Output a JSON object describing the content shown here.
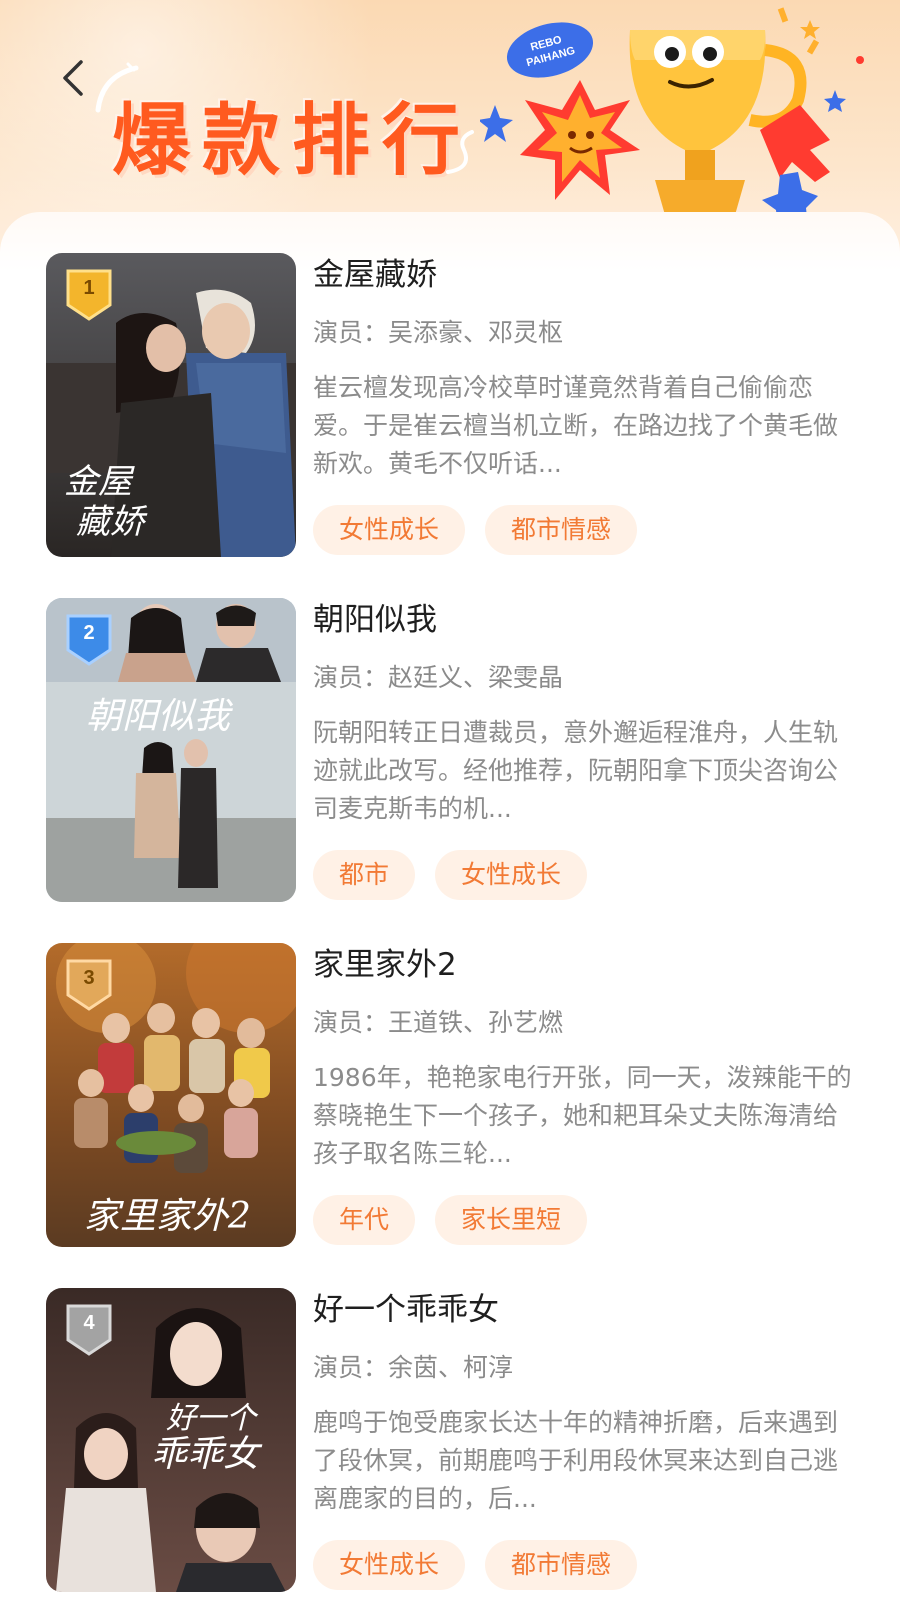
{
  "header": {
    "title": "爆款排行",
    "art_text": "REBO PAIHANG"
  },
  "colors": {
    "accent": "#ff5a1f",
    "tag_bg": "#fff1e6",
    "tag_text": "#f27a35",
    "rank_gold": "#f3b52c",
    "rank_blue": "#3d8be8",
    "rank_bronze": "#e2a85a",
    "rank_gray": "#a3a3a3"
  },
  "list": {
    "items": [
      {
        "rank": "1",
        "title": "金屋藏娇",
        "cast_label": "演员：",
        "cast": "吴添豪、邓灵枢",
        "synopsis": "崔云檀发现高冷校草时谨竟然背着自己偷偷恋爱。于是崔云檀当机立断，在路边找了个黄毛做新欢。黄毛不仅听话...",
        "tags": [
          "女性成长",
          "都市情感"
        ],
        "poster_text": "金屋藏娇"
      },
      {
        "rank": "2",
        "title": "朝阳似我",
        "cast_label": "演员：",
        "cast": "赵廷义、梁雯晶",
        "synopsis": "阮朝阳转正日遭裁员，意外邂逅程淮舟，人生轨迹就此改写。经他推荐，阮朝阳拿下顶尖咨询公司麦克斯韦的机...",
        "tags": [
          "都市",
          "女性成长"
        ],
        "poster_text": "朝阳似我"
      },
      {
        "rank": "3",
        "title": "家里家外2",
        "cast_label": "演员：",
        "cast": "王道铁、孙艺燃",
        "synopsis": "1986年，艳艳家电行开张，同一天，泼辣能干的蔡晓艳生下一个孩子，她和耙耳朵丈夫陈海清给孩子取名陈三轮...",
        "tags": [
          "年代",
          "家长里短"
        ],
        "poster_text": "家里家外2"
      },
      {
        "rank": "4",
        "title": "好一个乖乖女",
        "cast_label": "演员：",
        "cast": "余茵、柯淳",
        "synopsis": "鹿鸣于饱受鹿家长达十年的精神折磨，后来遇到了段休冥，前期鹿鸣于利用段休冥来达到自己逃离鹿家的目的，后...",
        "tags": [
          "女性成长",
          "都市情感"
        ],
        "poster_text": "好一个乖乖女"
      }
    ]
  }
}
